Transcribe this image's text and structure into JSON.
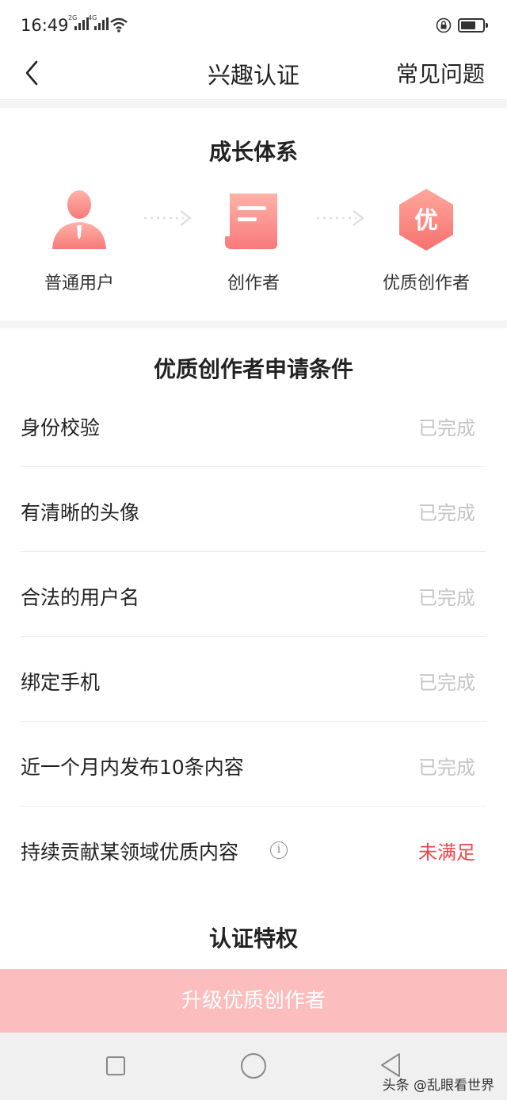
{
  "status_bar": {
    "time": "16:49",
    "net1": "2G",
    "net2": "4G",
    "battery_level": 0.7
  },
  "nav": {
    "title": "兴趣认证",
    "faq": "常见问题"
  },
  "growth": {
    "title": "成长体系",
    "stages": [
      {
        "label": "普通用户",
        "icon": "user-icon"
      },
      {
        "label": "创作者",
        "icon": "scroll-icon"
      },
      {
        "label": "优质创作者",
        "icon": "quality-badge-icon",
        "badge_text": "优"
      }
    ]
  },
  "conditions": {
    "title": "优质创作者申请条件",
    "rows": [
      {
        "name": "身份校验",
        "status": "已完成"
      },
      {
        "name": "有清晰的头像",
        "status": "已完成"
      },
      {
        "name": "合法的用户名",
        "status": "已完成"
      },
      {
        "name": "绑定手机",
        "status": "已完成"
      },
      {
        "name": "近一个月内发布10条内容",
        "status": "已完成"
      },
      {
        "name": "持续贡献某领域优质内容",
        "status": "未满足"
      }
    ],
    "info_glyph": "i"
  },
  "privileges_title": "认证特权",
  "upgrade_button": "升级优质创作者",
  "watermark": "头条 @乱眼看世界",
  "colors": {
    "accent": "#f77a7a",
    "unmet": "#f0464d",
    "done": "#c4c4c4",
    "button": "#fbbdbd"
  }
}
